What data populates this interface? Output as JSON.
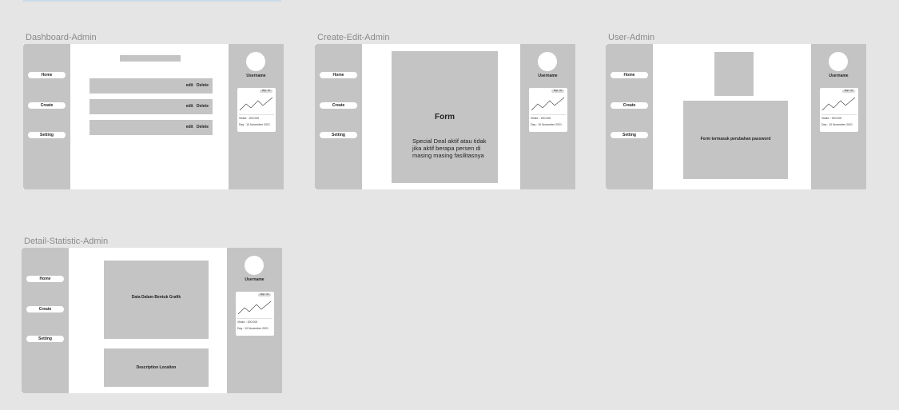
{
  "nav": {
    "home": "Home",
    "create": "Create",
    "setting": "Setting"
  },
  "profile": {
    "username": "Username",
    "badge": "Mgrt - 16",
    "visitor": "Visitor : 200.000",
    "day": "Day : 10 November 2021"
  },
  "frames": {
    "dashboard": {
      "label": "Dashboard-Admin",
      "rows": [
        {
          "edit": "edit",
          "delete": "Delete"
        },
        {
          "edit": "edit",
          "delete": "Delete"
        },
        {
          "edit": "edit",
          "delete": "Delete"
        }
      ]
    },
    "create_edit": {
      "label": "Create-Edit-Admin",
      "form_title": "Form",
      "form_desc": "Special Deal aktif atau tidak jika aktif berapa persen di masing masing fasilitasnya"
    },
    "user": {
      "label": "User-Admin",
      "form_text": "Form termasuk perubahan password"
    },
    "detail": {
      "label": "Detail-Statistic-Admin",
      "chart_text": "Data Dalam Bentuk Grafik",
      "desc_text": "Description Location",
      "badge": "Mgrt - 16",
      "visitor": "Visitor : 200.000",
      "day": "Day : 10 November 2021"
    }
  },
  "colors": {
    "sidebar": "#c4c4c4",
    "canvas": "#e5e5e5",
    "frame": "#ffffff"
  }
}
